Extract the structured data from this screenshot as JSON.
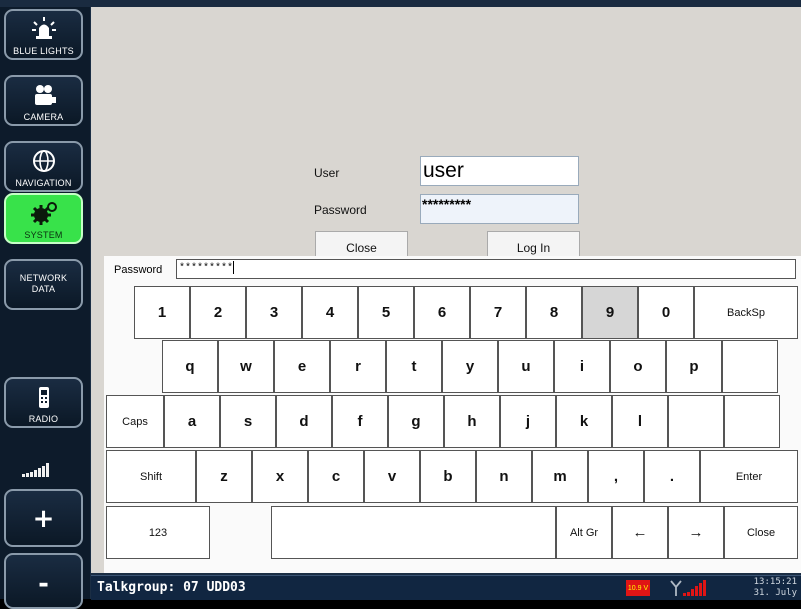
{
  "sidebar": {
    "items": [
      {
        "label": "BLUE LIGHTS",
        "icon": "siren-icon"
      },
      {
        "label": "CAMERA",
        "icon": "camera-icon"
      },
      {
        "label": "NAVIGATION",
        "icon": "globe-icon"
      },
      {
        "label": "SYSTEM",
        "icon": "gears-icon",
        "active": true
      },
      {
        "label": "NETWORK DATA"
      },
      {
        "label": "RADIO",
        "icon": "radio-handset-icon"
      }
    ],
    "volume_up": "+",
    "volume_down": "-"
  },
  "login": {
    "user_label": "User",
    "user_value": "user",
    "password_label": "Password",
    "password_value": "*********",
    "close_label": "Close",
    "login_label": "Log In"
  },
  "keyboard": {
    "field_label": "Password",
    "field_value": "*********",
    "row1": [
      "1",
      "2",
      "3",
      "4",
      "5",
      "6",
      "7",
      "8",
      "9",
      "0",
      "BackSp"
    ],
    "row2": [
      "q",
      "w",
      "e",
      "r",
      "t",
      "y",
      "u",
      "i",
      "o",
      "p",
      ""
    ],
    "row3": [
      "Caps",
      "a",
      "s",
      "d",
      "f",
      "g",
      "h",
      "j",
      "k",
      "l",
      "",
      ""
    ],
    "row4": [
      "Shift",
      "z",
      "x",
      "c",
      "v",
      "b",
      "n",
      "m",
      ",",
      ".",
      "Enter"
    ],
    "row5": [
      "123",
      "",
      "Alt Gr",
      "←",
      "→",
      "Close"
    ],
    "pressed_key": "9"
  },
  "status": {
    "talkgroup": "Talkgroup: 07 UDD03",
    "battery": "10.9 V",
    "time": "13:15:21",
    "date": "31. July"
  },
  "colors": {
    "active_green": "#38e24a",
    "sidebar_bg": "#0d1b2b",
    "status_bg": "#112641",
    "battery_red": "#e01515"
  }
}
